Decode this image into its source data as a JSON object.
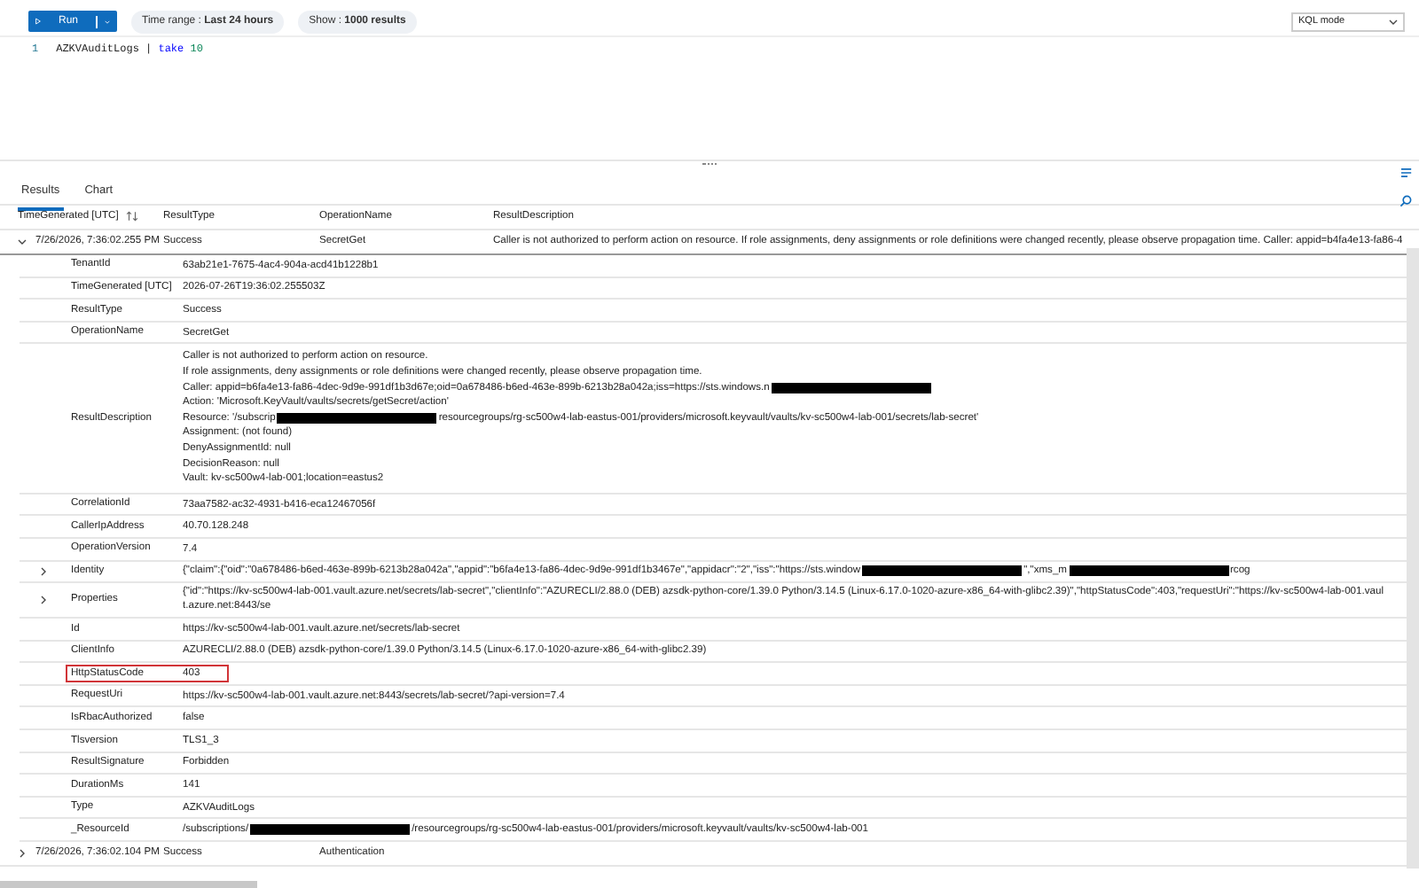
{
  "toolbar": {
    "run_label": "Run",
    "time_range": "Time range : **Last 24 hours**",
    "show": "Show : **1000 results**",
    "mode": "KQL mode"
  },
  "editor": {
    "line_number": "1",
    "tokens": [
      {
        "kind": "table",
        "text": "AZKVAuditLogs"
      },
      {
        "kind": "pipe",
        "text": "|"
      },
      {
        "kind": "keyword",
        "text": "take"
      },
      {
        "kind": "number",
        "text": "10"
      }
    ]
  },
  "tabs": [
    {
      "label": "Results",
      "selected": true
    },
    {
      "label": "Chart",
      "selected": false
    }
  ],
  "table": {
    "columns": [
      "TimeGenerated [UTC]",
      "ResultType",
      "OperationName",
      "ResultDescription"
    ],
    "rows": [
      {
        "expanded": true,
        "cells": [
          "7/26/2026, 7:36:02.255 PM",
          "Success",
          "SecretGet",
          "Caller is not authorized to perform action on resource. If role assignments, deny assignments or role definitions were changed recently, please observe propagation time. Caller: appid=b4fa4e13-fa86-4"
        ],
        "details": [
          {
            "label": "TenantId",
            "lines": [
              [
                {
                  "kind": "text",
                  "text": "63ab21e1-7675-4ac4-904a-acd41b1228b1"
                }
              ]
            ]
          },
          {
            "label": "TimeGenerated [UTC]",
            "lines": [
              [
                {
                  "kind": "text",
                  "text": "2026-07-26T19:36:02.255503Z"
                }
              ]
            ]
          },
          {
            "label": "ResultType",
            "lines": [
              [
                {
                  "kind": "text",
                  "text": "Success"
                }
              ]
            ]
          },
          {
            "label": "OperationName",
            "lines": [
              [
                {
                  "kind": "text",
                  "text": "SecretGet"
                }
              ]
            ]
          },
          {
            "label": "ResultDescription",
            "lines": [
              [
                {
                  "kind": "text",
                  "text": "Caller is not authorized to perform action on resource."
                }
              ],
              [
                {
                  "kind": "text",
                  "text": "If role assignments, deny assignments or role definitions were changed recently, please observe propagation time."
                }
              ],
              [
                {
                  "kind": "text",
                  "text": "Caller: appid=b6fa4e13-fa86-4dec-9d9e-991df1b3d67e;oid=0a678486-b6ed-463e-899b-6213b28a042a;iss=https://sts.windows.n"
                },
                {
                  "kind": "redaction"
                }
              ],
              [
                {
                  "kind": "text",
                  "text": "Action: 'Microsoft.KeyVault/vaults/secrets/getSecret/action'"
                }
              ],
              [
                {
                  "kind": "text",
                  "text": "Resource: '/subscrip"
                },
                {
                  "kind": "redaction"
                },
                {
                  "kind": "text",
                  "text": "resourcegroups/rg-sc500w4-lab-eastus-001/providers/microsoft.keyvault/vaults/kv-sc500w4-lab-001/secrets/lab-secret'"
                }
              ],
              [
                {
                  "kind": "text",
                  "text": "Assignment: (not found)"
                }
              ],
              [
                {
                  "kind": "text",
                  "text": "DenyAssignmentId: null"
                }
              ],
              [
                {
                  "kind": "text",
                  "text": "DecisionReason: null"
                }
              ],
              [
                {
                  "kind": "text",
                  "text": "Vault: kv-sc500w4-lab-001;location=eastus2"
                }
              ]
            ]
          },
          {
            "label": "CorrelationId",
            "lines": [
              [
                {
                  "kind": "text",
                  "text": "73aa7582-ac32-4931-b416-eca12467056f"
                }
              ]
            ]
          },
          {
            "label": "CallerIpAddress",
            "lines": [
              [
                {
                  "kind": "text",
                  "text": "40.70.128.248"
                }
              ]
            ]
          },
          {
            "label": "OperationVersion",
            "lines": [
              [
                {
                  "kind": "text",
                  "text": "7.4"
                }
              ]
            ]
          },
          {
            "label": "Identity",
            "expanded": false,
            "lines": [
              [
                {
                  "kind": "text",
                  "text": "{\"claim\":{\"oid\":\"0a678486-b6ed-463e-899b-6213b28a042a\",\"appid\":\"b6fa4e13-fa86-4dec-9d9e-991df1b3467e\",\"appidacr\":\"2\",\"iss\":\"https://sts.window"
                },
                {
                  "kind": "redaction"
                },
                {
                  "kind": "text",
                  "text": "\",\"xms_m"
                },
                {
                  "kind": "redaction"
                },
                {
                  "kind": "text",
                  "text": "rcog"
                }
              ]
            ]
          },
          {
            "label": "Properties",
            "expanded": false,
            "lines": [
              [
                {
                  "kind": "text",
                  "text": "{\"id\":\"https://kv-sc500w4-lab-001.vault.azure.net/secrets/lab-secret\",\"clientInfo\":\"AZURECLI/2.88.0 (DEB) azsdk-python-core/1.39.0 Python/3.14.5 (Linux-6.17.0-1020-azure-x86_64-with-glibc2.39)\",\"httpStatusCode\":403,\"requestUri\":\"https://kv-sc500w4-lab-001.vault.azure.net:8443/se"
                }
              ]
            ]
          },
          {
            "label": "Id",
            "lines": [
              [
                {
                  "kind": "text",
                  "text": "https://kv-sc500w4-lab-001.vault.azure.net/secrets/lab-secret"
                }
              ]
            ]
          },
          {
            "label": "ClientInfo",
            "lines": [
              [
                {
                  "kind": "text",
                  "text": "AZURECLI/2.88.0 (DEB) azsdk-python-core/1.39.0 Python/3.14.5 (Linux-6.17.0-1020-azure-x86_64-with-glibc2.39)"
                }
              ]
            ]
          },
          {
            "label": "HttpStatusCode",
            "highlighted": true,
            "lines": [
              [
                {
                  "kind": "text",
                  "text": "403"
                }
              ]
            ]
          },
          {
            "label": "RequestUri",
            "lines": [
              [
                {
                  "kind": "text",
                  "text": "https://kv-sc500w4-lab-001.vault.azure.net:8443/secrets/lab-secret/?api-version=7.4"
                }
              ]
            ]
          },
          {
            "label": "IsRbacAuthorized",
            "lines": [
              [
                {
                  "kind": "text",
                  "text": "false"
                }
              ]
            ]
          },
          {
            "label": "Tlsversion",
            "lines": [
              [
                {
                  "kind": "text",
                  "text": "TLS1_3"
                }
              ]
            ]
          },
          {
            "label": "ResultSignature",
            "lines": [
              [
                {
                  "kind": "text",
                  "text": "Forbidden"
                }
              ]
            ]
          },
          {
            "label": "DurationMs",
            "lines": [
              [
                {
                  "kind": "text",
                  "text": "141"
                }
              ]
            ]
          },
          {
            "label": "Type",
            "lines": [
              [
                {
                  "kind": "text",
                  "text": "AZKVAuditLogs"
                }
              ]
            ]
          },
          {
            "label": "_ResourceId",
            "lines": [
              [
                {
                  "kind": "text",
                  "text": "/subscriptions/"
                },
                {
                  "kind": "redaction"
                },
                {
                  "kind": "text",
                  "text": "/resourcegroups/rg-sc500w4-lab-eastus-001/providers/microsoft.keyvault/vaults/kv-sc500w4-lab-001"
                }
              ]
            ]
          }
        ]
      },
      {
        "expanded": false,
        "cells": [
          "7/26/2026, 7:36:02.104 PM",
          "Success",
          "Authentication"
        ]
      }
    ]
  }
}
